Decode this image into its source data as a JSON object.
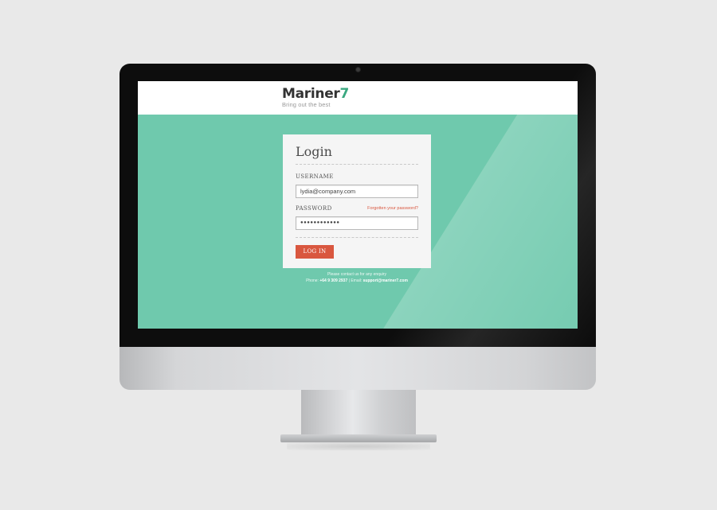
{
  "brand": {
    "name_main": "Mariner",
    "name_num": "7",
    "tagline": "Bring out the best",
    "accent_color": "#3aa880"
  },
  "login": {
    "title": "Login",
    "username_label": "USERNAME",
    "username_value": "lydia@company.com",
    "password_label": "PASSWORD",
    "forgot_link": "Forgotten your password?",
    "password_value": "●●●●●●●●●●●●",
    "submit_label": "LOG IN",
    "button_color": "#d9573f"
  },
  "contact": {
    "line1": "Please contact us for any enquiry",
    "phone_label": "Phone:",
    "phone": "+64 9 309 2937",
    "separator": " | Email:",
    "email": "support@mariner7.com"
  },
  "theme": {
    "background_color": "#6fc9ad"
  }
}
